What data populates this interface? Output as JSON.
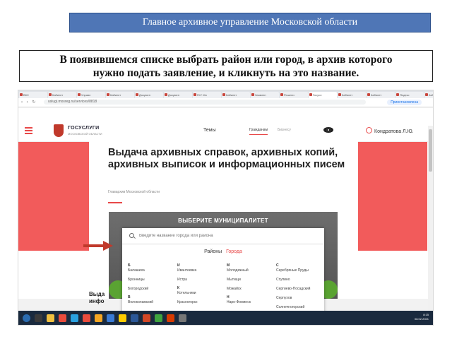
{
  "slide": {
    "banner": "Главное архивное управление Московской области",
    "instruction_line1": "В появившемся списке выбрать район или город, в архив которого",
    "instruction_line2": "нужно подать заявление, и кликнуть на это название."
  },
  "browser": {
    "tabs": [
      "ВКС",
      "Кабинет",
      "Управл",
      "Кабинет",
      "Докумен",
      "Докумен",
      "ГКУ Мо",
      "Кабинет",
      "Заявлен",
      "Решени",
      "Госусл",
      "Кабинет",
      "Кабинет",
      "Яндекс",
      "Кабинет",
      "госусл"
    ],
    "url": "uslugi.mosreg.ru/services/8818",
    "profile_button": "Приостановлена"
  },
  "site": {
    "logo_title": "ГОСУСЛУГИ",
    "logo_subtitle": "МОСКОВСКОЙ ОБЛАСТИ",
    "nav_topics": "Темы",
    "nav_citizens": "Гражданам",
    "nav_business": "Бизнесу",
    "user_name": "Кондратова Л.Ю.",
    "page_title": "Выдача архивных справок, архивных копий, архивных выписок и информационных писем",
    "page_org": "Главархив Московской области",
    "page_title_cut": "Выда",
    "page_title_cut2": "инфо"
  },
  "municipality": {
    "title": "ВЫБЕРИТЕ МУНИЦИПАЛИТЕТ",
    "search_placeholder": "Введите название города или района",
    "toggle_districts": "Районы",
    "toggle_cities": "Города",
    "columns": [
      {
        "groups": [
          {
            "letter": "Б",
            "items": [
              "Балашиха",
              "Бронницы",
              "Богородский"
            ]
          },
          {
            "letter": "В",
            "items": [
              "Волоколамский"
            ]
          }
        ]
      },
      {
        "groups": [
          {
            "letter": "И",
            "items": [
              "Ивантеевка",
              "Истра"
            ]
          },
          {
            "letter": "К",
            "items": [
              "Котельники",
              "Красногорск"
            ]
          }
        ]
      },
      {
        "groups": [
          {
            "letter": "М",
            "items": [
              "Молодежный",
              "Мытищи",
              "Можайск"
            ]
          },
          {
            "letter": "Н",
            "items": [
              "Наро-Фоминск"
            ]
          }
        ]
      },
      {
        "groups": [
          {
            "letter": "С",
            "items": [
              "Серебряные Пруды",
              "Ступино",
              "Сергиево-Посадский",
              "Серпухов",
              "Солнечногорский"
            ]
          }
        ]
      }
    ]
  },
  "taskbar": {
    "time": "8:15",
    "date": "08.02.2021"
  },
  "colors": {
    "banner_bg": "#4f76b6",
    "brand_red": "#f25b5b",
    "arrow": "#c0392b"
  }
}
